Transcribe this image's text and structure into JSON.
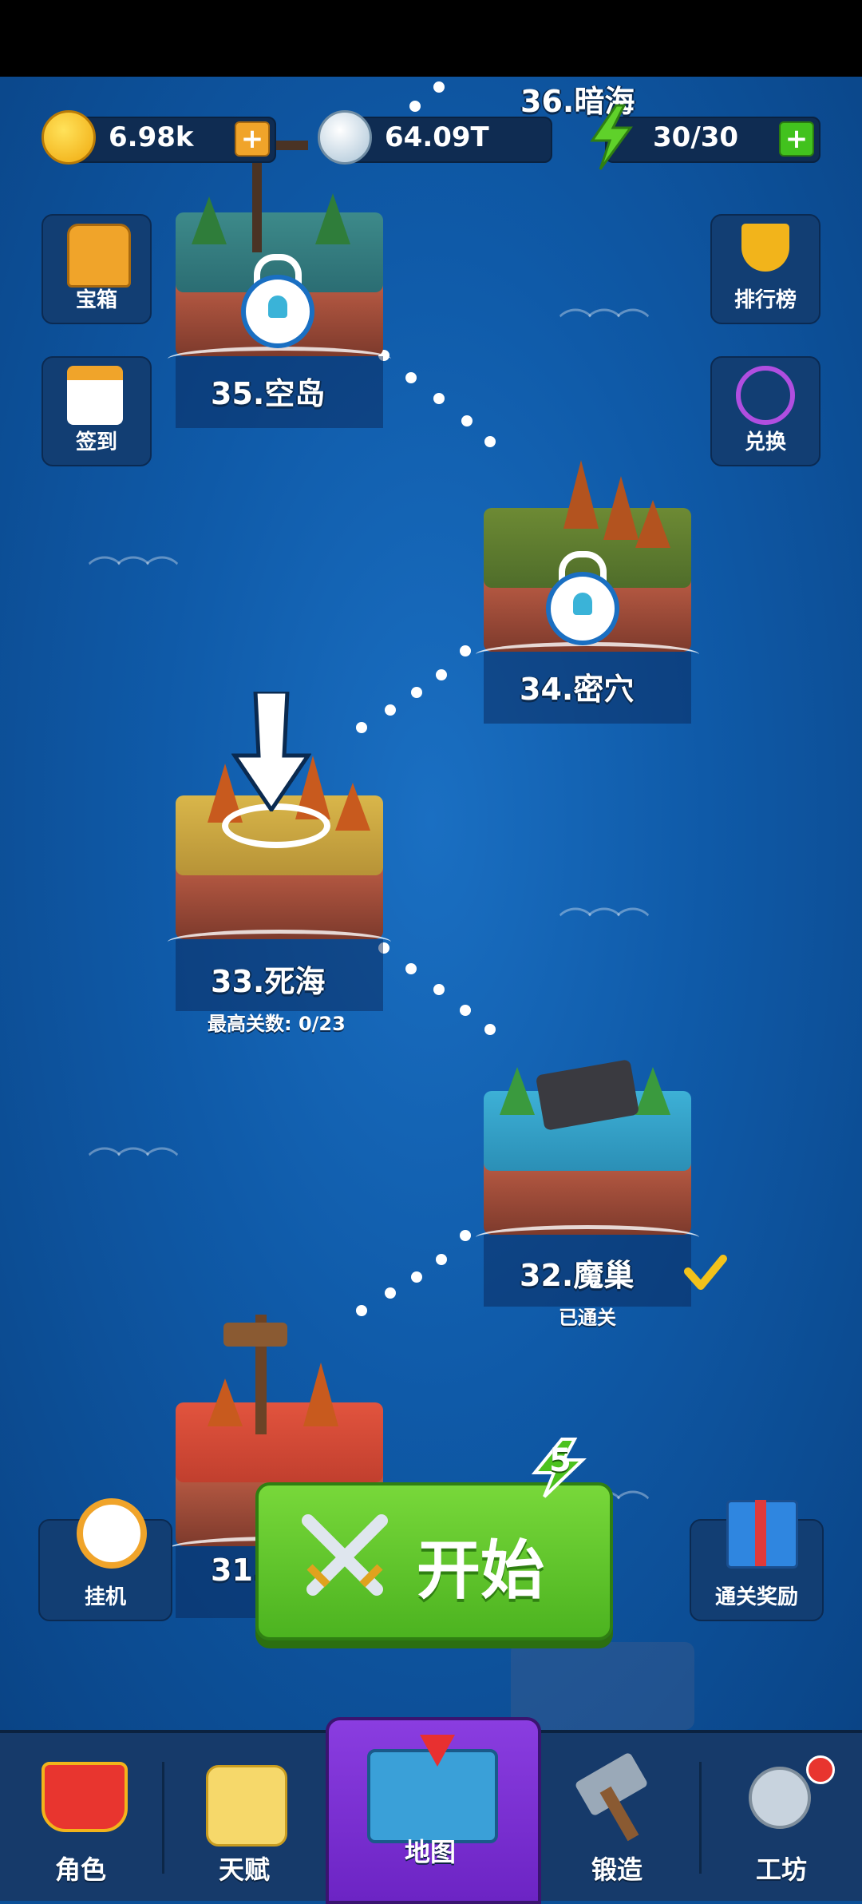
{
  "resources": {
    "gold": "6.98k",
    "silver": "64.09T",
    "energy": "30/30"
  },
  "side_buttons": {
    "chest": "宝箱",
    "checkin": "签到",
    "ranking": "排行榜",
    "redeem": "兑换",
    "idle": "挂机",
    "clear_reward": "通关奖励"
  },
  "islands": [
    {
      "name": "36.暗海"
    },
    {
      "name": "35.空岛"
    },
    {
      "name": "34.密穴"
    },
    {
      "name": "33.死海",
      "sub": "最高关数: 0/23"
    },
    {
      "name": "32.魔巢",
      "sub": "已通关"
    },
    {
      "name": "31."
    }
  ],
  "start_button": {
    "label": "开始",
    "cost": "5"
  },
  "nav": {
    "role": "角色",
    "talent": "天赋",
    "map": "地图",
    "forge": "锻造",
    "workshop": "工坊"
  },
  "colors": {
    "sea": "#1a6fc2",
    "start_green": "#5cc42a",
    "nav_active": "#7a2fd4",
    "energy_green": "#4cc21e"
  }
}
